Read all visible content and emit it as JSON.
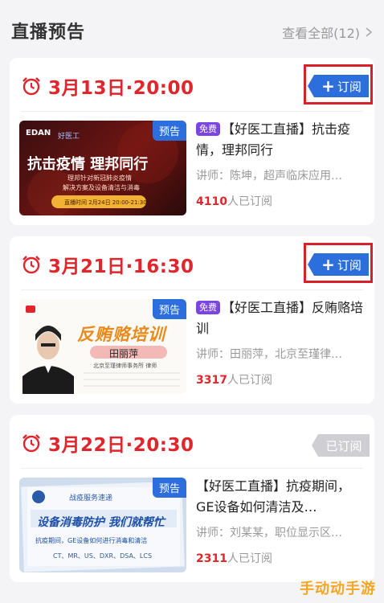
{
  "header": {
    "title": "直播预告",
    "view_all": "查看全部(12)"
  },
  "cards": [
    {
      "time": "3月13日·20:00",
      "subscribe_label": "订阅",
      "thumb_badge": "预告",
      "thumb": {
        "logo": "EDAN",
        "brand": "好医工",
        "headline": "抗击疫情 理邦同行",
        "line1": "理邦针对新冠肺炎疫情",
        "line2": "解决方案及设备清洁与消毒",
        "live": "直播时间 2月24日 20:00-21:30"
      },
      "free_tag": "免费",
      "title": "【好医工直播】抗击疫情，理邦同行",
      "lecturer": "讲师：陈坤，超声临床应用…",
      "count": "4110",
      "count_suffix": "人已订阅"
    },
    {
      "time": "3月21日·16:30",
      "subscribe_label": "订阅",
      "thumb_badge": "预告",
      "thumb": {
        "headline": "反贿赂培训",
        "speaker": "田丽萍",
        "org": "北京至瑾律师事务所 律师"
      },
      "free_tag": "免费",
      "title": "【好医工直播】反贿赂培训",
      "lecturer": "讲师：田丽萍，北京至瑾律…",
      "count": "3317",
      "count_suffix": "人已订阅"
    },
    {
      "time": "3月22日·20:30",
      "subscribed_label": "已订阅",
      "thumb_badge": "预告",
      "thumb": {
        "banner": "战疫服务速递",
        "headline": "设备消毒防护 我们就帮忙",
        "sub": "抗疫期间，GE设备如何进行消毒和清洁",
        "models": "CT、MR、US、DXR、DSA、LCS"
      },
      "title": "【好医工直播】抗疫期间，GE设备如何清洁及…",
      "lecturer": "讲师：刘某某，职位显示区…",
      "count": "2311",
      "count_suffix": "人已订阅"
    }
  ],
  "watermark": "手动动手游",
  "colors": {
    "accent_red": "#e0262c",
    "accent_blue": "#2c6fdc",
    "free_purple": "#7a45e0"
  }
}
